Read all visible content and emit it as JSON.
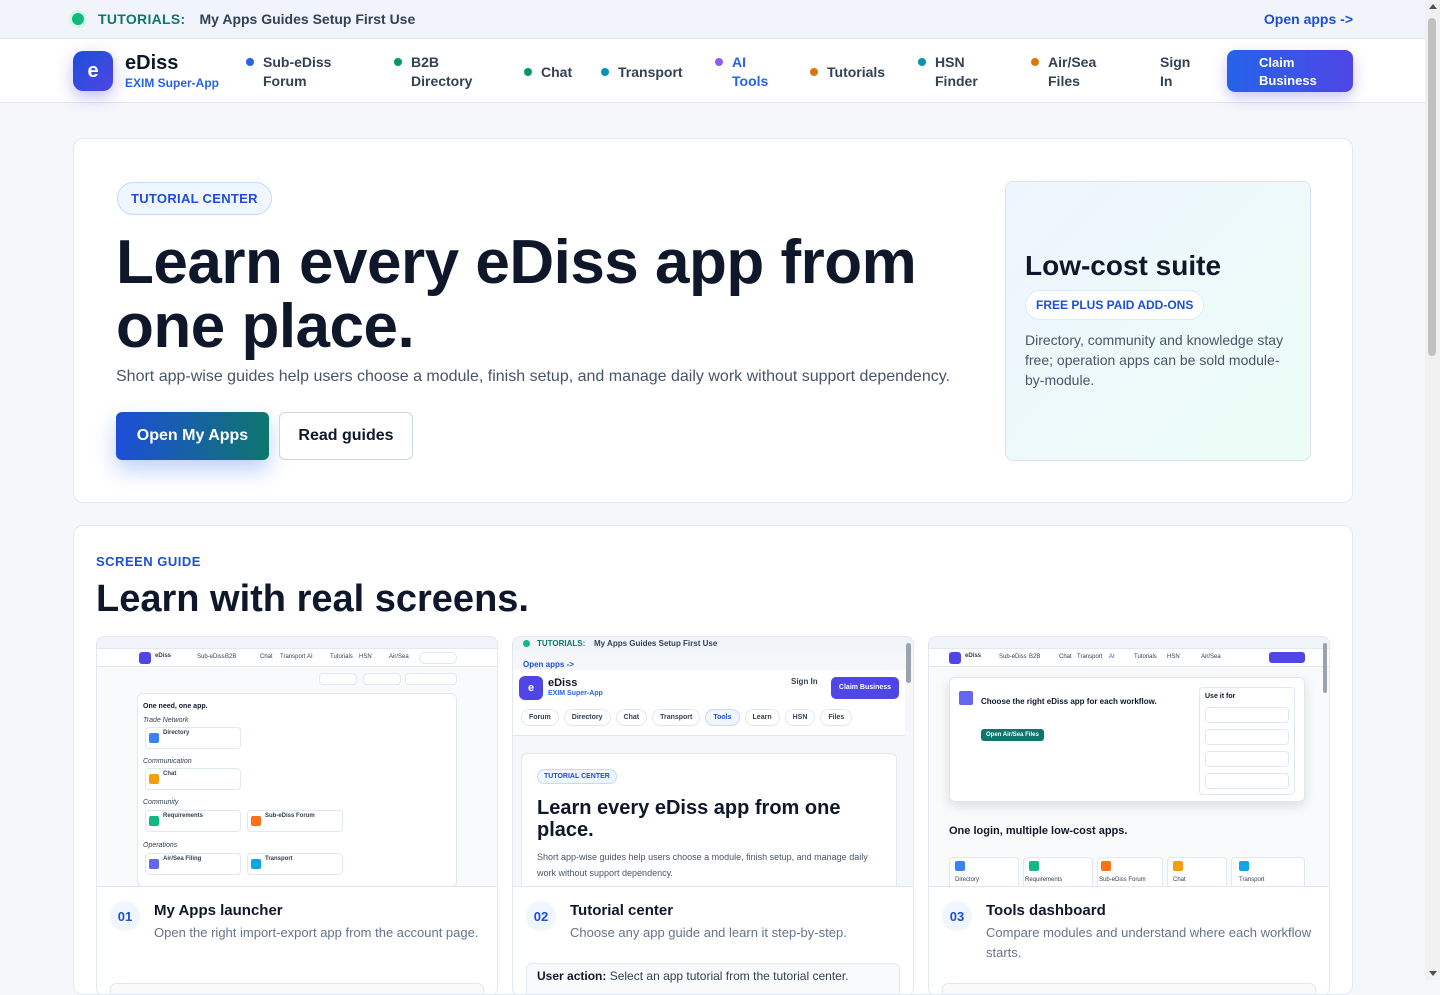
{
  "topbar": {
    "kicker": "TUTORIALS:",
    "text": "My Apps Guides Setup First Use",
    "link": "Open apps ->"
  },
  "brand": {
    "letter": "e",
    "name": "eDiss",
    "subtitle": "EXIM Super-App"
  },
  "nav": {
    "items": [
      {
        "label": "Sub-eDiss Forum",
        "color": "#2563eb"
      },
      {
        "label": "B2B Directory",
        "color": "#059669"
      },
      {
        "label": "Chat",
        "color": "#059669"
      },
      {
        "label": "Transport",
        "color": "#0891b2"
      },
      {
        "label": "AI Tools",
        "color": "#8b5cf6"
      },
      {
        "label": "Tutorials",
        "color": "#d97706"
      },
      {
        "label": "HSN Finder",
        "color": "#0891b2"
      },
      {
        "label": "Air/Sea Files",
        "color": "#d97706"
      }
    ],
    "signin": "Sign In",
    "claim": "Claim Business"
  },
  "hero": {
    "pill": "TUTORIAL CENTER",
    "title": "Learn every eDiss app from one place.",
    "description": "Short app-wise guides help users choose a module, finish setup, and manage daily work without support dependency.",
    "primary_button": "Open My Apps",
    "secondary_button": "Read guides",
    "side": {
      "title": "Low-cost suite",
      "tag": "FREE PLUS PAID ADD-ONS",
      "text": "Directory, community and knowledge stay free; operation apps can be sold module-by-module."
    }
  },
  "guide": {
    "kicker": "SCREEN GUIDE",
    "title": "Learn with real screens.",
    "cards": [
      {
        "num": "01",
        "title": "My Apps launcher",
        "desc": "Open the right import-export app from the account page.",
        "shot": {
          "heading": "One need, one app.",
          "groups": [
            "Trade Network",
            "Communication",
            "Community",
            "Operations"
          ],
          "apps": [
            "Directory",
            "Chat",
            "Requirements",
            "Sub-eDiss Forum",
            "Air/Sea Filing",
            "Transport"
          ]
        }
      },
      {
        "num": "02",
        "title": "Tutorial center",
        "desc": "Choose any app guide and learn it step-by-step.",
        "note_label": "User action:",
        "note_text": "Select an app tutorial from the tutorial center.",
        "shot": {
          "kicker": "TUTORIALS:",
          "bar_text": "My Apps Guides Setup First Use",
          "open_apps": "Open apps ->",
          "brand": "eDiss",
          "brand_sub": "EXIM Super-App",
          "signin": "Sign In",
          "claim": "Claim Business",
          "chips": [
            "Forum",
            "Directory",
            "Chat",
            "Transport",
            "Tools",
            "Learn",
            "HSN",
            "Files"
          ],
          "pill": "TUTORIAL CENTER",
          "title": "Learn every eDiss app from one place.",
          "desc": "Short app-wise guides help users choose a module, finish setup, and manage daily work without support dependency."
        }
      },
      {
        "num": "03",
        "title": "Tools dashboard",
        "desc": "Compare modules and understand where each workflow starts.",
        "shot": {
          "heading": "Choose the right eDiss app for each workflow.",
          "use_it_for": "Use it for",
          "button": "Open Air/Sea Files",
          "sub_heading": "One login, multiple low-cost apps.",
          "apps": [
            "Directory",
            "Requirements",
            "Sub-eDiss Forum",
            "Chat",
            "Transport"
          ]
        }
      }
    ]
  }
}
